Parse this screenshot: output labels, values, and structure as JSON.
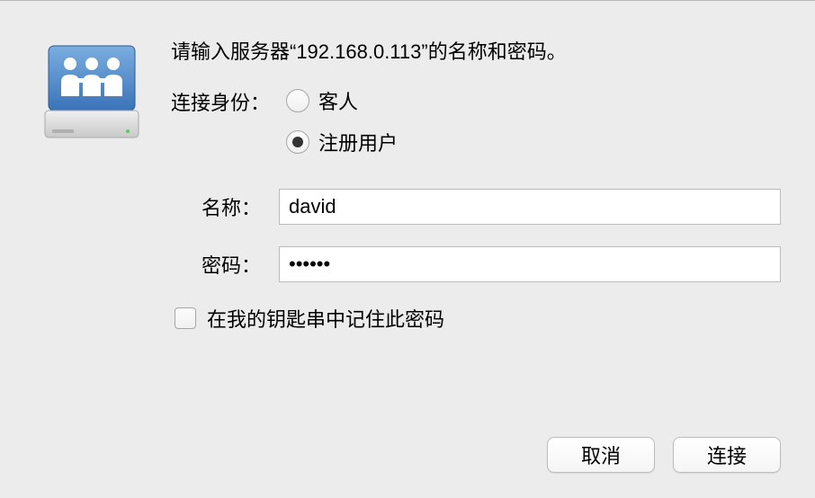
{
  "prompt": "请输入服务器“192.168.0.113”的名称和密码。",
  "identity": {
    "label": "连接身份：",
    "guest": "客人",
    "registered": "注册用户"
  },
  "fields": {
    "name_label": "名称：",
    "name_value": "david",
    "password_label": "密码：",
    "password_value": "••••••"
  },
  "remember": {
    "label": "在我的钥匙串中记住此密码"
  },
  "buttons": {
    "cancel": "取消",
    "connect": "连接"
  }
}
